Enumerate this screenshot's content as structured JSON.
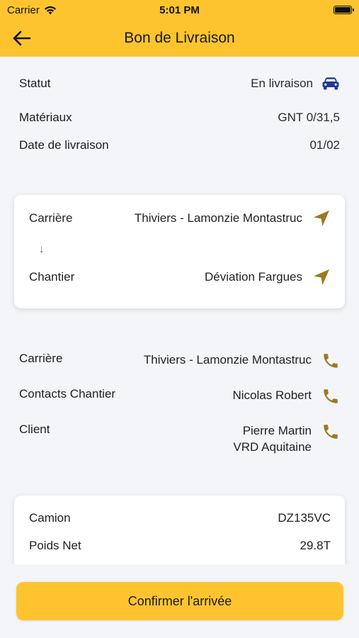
{
  "status_bar": {
    "carrier": "Carrier",
    "time": "5:01 PM"
  },
  "header": {
    "title": "Bon de Livraison"
  },
  "summary": {
    "statut_label": "Statut",
    "statut_value": "En livraison",
    "materiaux_label": "Matériaux",
    "materiaux_value": "GNT 0/31,5",
    "date_label": "Date de livraison",
    "date_value": "01/02"
  },
  "route": {
    "carriere_label": "Carrière",
    "carriere_value": "Thiviers - Lamonzie Montastruc",
    "arrow": "↓",
    "chantier_label": "Chantier",
    "chantier_value": "Déviation Fargues"
  },
  "contacts": {
    "carriere_label": "Carrière",
    "carriere_value": "Thiviers - Lamonzie Montastruc",
    "chantier_label": "Contacts Chantier",
    "chantier_value": "Nicolas Robert",
    "client_label": "Client",
    "client_name": "Pierre Martin",
    "client_company": "VRD Aquitaine"
  },
  "vehicle": {
    "camion_label": "Camion",
    "camion_value": "DZ135VC",
    "poids_label": "Poids Net",
    "poids_value": "29.8T"
  },
  "actions": {
    "confirm_label": "Confirmer l'arrivée"
  },
  "colors": {
    "accent": "#FDC42F",
    "icon_gold": "#9C7A22",
    "car_blue": "#1F3A93",
    "background": "#F3F5F8"
  },
  "icons": [
    "back-arrow-icon",
    "wifi-icon",
    "battery-icon",
    "car-icon",
    "navigation-icon",
    "phone-icon"
  ]
}
